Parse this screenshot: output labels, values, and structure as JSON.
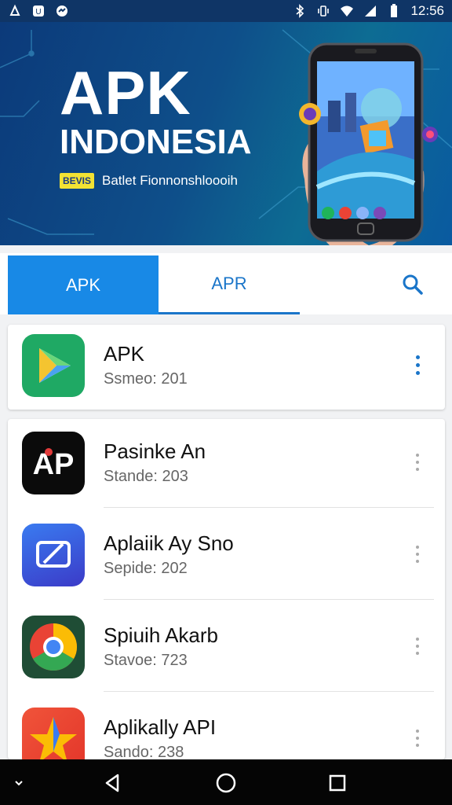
{
  "status_bar": {
    "time": "12:56",
    "left_icons": [
      "notification-icon",
      "app-icon",
      "sync-icon"
    ],
    "right_icons": [
      "bluetooth-icon",
      "vibrate-icon",
      "wifi-icon",
      "signal-icon",
      "battery-icon"
    ]
  },
  "hero": {
    "title": "APK",
    "subtitle": "INDONESIA",
    "badge": "BEVIS",
    "tagline": "Batlet Fionnonshloooih"
  },
  "tabs": [
    {
      "label": "APK",
      "active": true
    },
    {
      "label": "APR",
      "active": false
    }
  ],
  "featured": {
    "name": "APK",
    "meta": "Ssmeo: 201",
    "icon": "play-store-icon"
  },
  "apps": [
    {
      "name": "Pasinke An",
      "meta": "Stande: 203",
      "icon": "ap-logo-icon"
    },
    {
      "name": "Aplaiik Ay Sno",
      "meta": "Sepide: 202",
      "icon": "screen-cast-icon"
    },
    {
      "name": "Spiuih Akarb",
      "meta": "Stavoe: 723",
      "icon": "chrome-icon"
    },
    {
      "name": "Aplikally API",
      "meta": "Sando: 238",
      "icon": "star-icon"
    }
  ],
  "nav": {
    "icons": [
      "collapse-icon",
      "back-icon",
      "home-icon",
      "recents-icon"
    ]
  },
  "colors": {
    "accent": "#1889e6",
    "hero_bg": "#0c3a7a",
    "tab_text": "#1a75c9"
  }
}
